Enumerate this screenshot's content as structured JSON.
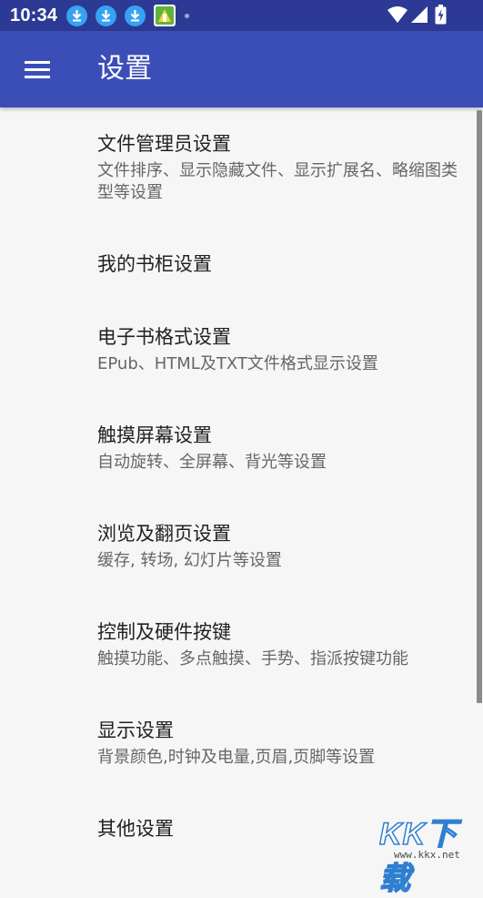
{
  "status_bar": {
    "time": "10:34",
    "notification_icons": [
      "download-icon",
      "download-icon",
      "download-icon",
      "app-icon"
    ],
    "right_icons": [
      "wifi-icon",
      "signal-icon",
      "battery-charging-icon"
    ]
  },
  "app_bar": {
    "title": "设置",
    "nav_icon": "menu-icon"
  },
  "settings": [
    {
      "title": "文件管理员设置",
      "subtitle": "文件排序、显示隐藏文件、显示扩展名、略缩图类型等设置"
    },
    {
      "title": "我的书柜设置",
      "subtitle": ""
    },
    {
      "title": "电子书格式设置",
      "subtitle": "EPub、HTML及TXT文件格式显示设置"
    },
    {
      "title": "触摸屏幕设置",
      "subtitle": "自动旋转、全屏幕、背光等设置"
    },
    {
      "title": "浏览及翻页设置",
      "subtitle": "缓存, 转场, 幻灯片等设置"
    },
    {
      "title": "控制及硬件按键",
      "subtitle": "触摸功能、多点触摸、手势、指派按键功能"
    },
    {
      "title": "显示设置",
      "subtitle": "背景颜色,时钟及电量,页眉,页脚等设置"
    },
    {
      "title": "其他设置",
      "subtitle": ""
    }
  ],
  "watermark": {
    "text": "KK下载",
    "url": "www.kkx.net"
  },
  "colors": {
    "status_bar": "#2c3a95",
    "app_bar": "#3b4eb8",
    "background": "#f6f6f6",
    "download_badge": "#36a3f0"
  }
}
